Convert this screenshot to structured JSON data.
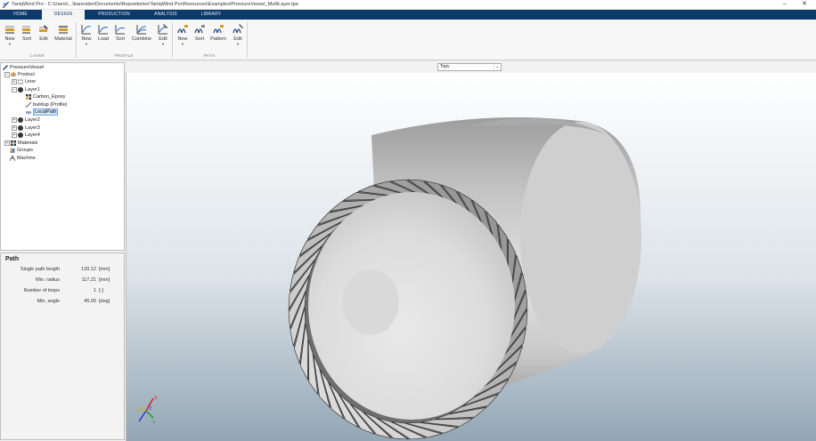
{
  "window": {
    "title": "TaniqWind Pro - C:\\Users\\...\\barendse\\Documents\\Repositories\\TaniqWind Pro\\Resources\\Examples\\PressureVessel_MultiLayer.tpe",
    "minimize_glyph": "–",
    "close_glyph": "✕"
  },
  "ribbon": {
    "tabs": [
      {
        "label": "HOME"
      },
      {
        "label": "DESIGN"
      },
      {
        "label": "PRODUCTION"
      },
      {
        "label": "ANALYSIS"
      },
      {
        "label": "LIBRARY"
      }
    ],
    "active_tab": "DESIGN",
    "groups": [
      {
        "label": "LAYER",
        "buttons": [
          {
            "label": "New",
            "icon": "new-layer-icon"
          },
          {
            "label": "Sort",
            "icon": "sort-icon"
          },
          {
            "label": "Edit",
            "icon": "edit-icon"
          },
          {
            "label": "Material",
            "icon": "material-icon"
          }
        ]
      },
      {
        "label": "PROFILE",
        "buttons": [
          {
            "label": "New",
            "icon": "new-profile-icon"
          },
          {
            "label": "Load",
            "icon": "load-icon"
          },
          {
            "label": "Sort",
            "icon": "sort-icon"
          },
          {
            "label": "Combine",
            "icon": "combine-icon"
          },
          {
            "label": "Edit",
            "icon": "edit-icon"
          }
        ]
      },
      {
        "label": "PATH",
        "buttons": [
          {
            "label": "New",
            "icon": "new-path-icon"
          },
          {
            "label": "Sort",
            "icon": "sort-icon"
          },
          {
            "label": "Pattern",
            "icon": "pattern-icon"
          },
          {
            "label": "Edit",
            "icon": "edit-icon"
          }
        ]
      }
    ],
    "accent": "#0d3a6b"
  },
  "tree": {
    "items": [
      {
        "label": "PressureVessel",
        "icon": "project-icon"
      },
      {
        "label": "Product",
        "icon": "product-icon"
      },
      {
        "label": "Liner",
        "icon": "liner-icon"
      },
      {
        "label": "Layer1",
        "icon": "layer-icon"
      },
      {
        "label": "Carbon_Epoxy",
        "icon": "material-icon"
      },
      {
        "label": "buildup (Profile)",
        "icon": "profile-icon"
      },
      {
        "label": "LocalPath",
        "icon": "path-icon"
      },
      {
        "label": "Layer2",
        "icon": "layer-icon"
      },
      {
        "label": "Layer3",
        "icon": "layer-icon"
      },
      {
        "label": "Layer4",
        "icon": "layer-icon"
      },
      {
        "label": "Materials",
        "icon": "materials-icon"
      },
      {
        "label": "Groups",
        "icon": "groups-icon"
      },
      {
        "label": "Machine",
        "icon": "machine-icon"
      }
    ],
    "selected": "LocalPath"
  },
  "properties": {
    "title": "Path",
    "rows": [
      {
        "name": "Single path length",
        "value": "120.12",
        "unit": "[mm]"
      },
      {
        "name": "Min. radius",
        "value": "117.21",
        "unit": "[mm]"
      },
      {
        "name": "Number of loops",
        "value": "1",
        "unit": "[-]"
      },
      {
        "name": "Min. angle",
        "value": "45.00",
        "unit": "[deg]"
      }
    ]
  },
  "viewport": {
    "view_option": "Topv",
    "axes": {
      "x": "X",
      "y": "Y",
      "z": "Z"
    }
  }
}
